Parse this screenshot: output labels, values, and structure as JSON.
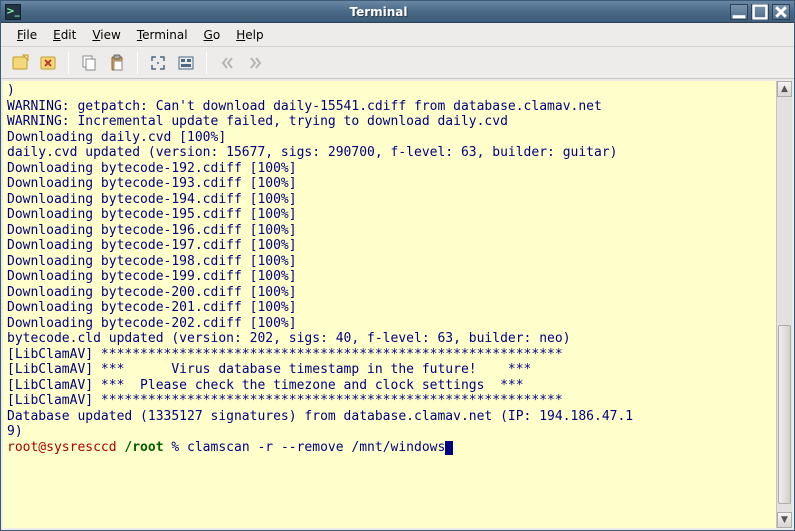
{
  "window": {
    "title": "Terminal"
  },
  "menubar": {
    "file": {
      "label": "File",
      "mnemonic": "F"
    },
    "edit": {
      "label": "Edit",
      "mnemonic": "E"
    },
    "view": {
      "label": "View",
      "mnemonic": "V"
    },
    "term": {
      "label": "Terminal",
      "mnemonic": "T"
    },
    "go": {
      "label": "Go",
      "mnemonic": "G"
    },
    "help": {
      "label": "Help",
      "mnemonic": "H"
    }
  },
  "toolbar": {
    "new_tab": "New Tab",
    "close_tab": "Close Tab",
    "copy": "Copy",
    "paste": "Paste",
    "fullscreen": "Fullscreen",
    "settings": "Settings",
    "prev": "Previous",
    "next": "Next"
  },
  "terminal": {
    "lines": [
      ")",
      "WARNING: getpatch: Can't download daily-15541.cdiff from database.clamav.net",
      "WARNING: Incremental update failed, trying to download daily.cvd",
      "Downloading daily.cvd [100%]",
      "daily.cvd updated (version: 15677, sigs: 290700, f-level: 63, builder: guitar)",
      "Downloading bytecode-192.cdiff [100%]",
      "Downloading bytecode-193.cdiff [100%]",
      "Downloading bytecode-194.cdiff [100%]",
      "Downloading bytecode-195.cdiff [100%]",
      "Downloading bytecode-196.cdiff [100%]",
      "Downloading bytecode-197.cdiff [100%]",
      "Downloading bytecode-198.cdiff [100%]",
      "Downloading bytecode-199.cdiff [100%]",
      "Downloading bytecode-200.cdiff [100%]",
      "Downloading bytecode-201.cdiff [100%]",
      "Downloading bytecode-202.cdiff [100%]",
      "bytecode.cld updated (version: 202, sigs: 40, f-level: 63, builder: neo)",
      "[LibClamAV] ***********************************************************",
      "[LibClamAV] ***      Virus database timestamp in the future!    ***",
      "[LibClamAV] ***  Please check the timezone and clock settings  ***",
      "[LibClamAV] ***********************************************************",
      "Database updated (1335127 signatures) from database.clamav.net (IP: 194.186.47.1",
      "9)"
    ],
    "prompt": {
      "user_host": "root@sysresccd",
      "path": "/root",
      "sep": " % ",
      "command": "clamscan -r --remove /mnt/windows"
    }
  },
  "colors": {
    "terminal_bg": "#ffffcc",
    "terminal_fg": "#000080",
    "prompt_user": "#aa0000",
    "prompt_path": "#006000"
  }
}
